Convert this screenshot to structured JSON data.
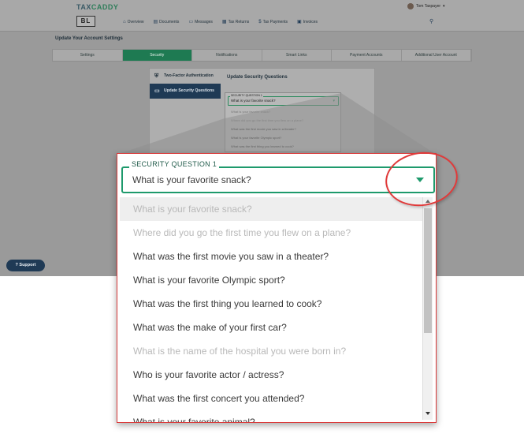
{
  "app": {
    "brand_tax": "TAX",
    "brand_caddy": "CADDY",
    "logo": "BL",
    "user_name": "Tom Taxpayer",
    "nav": [
      {
        "label": "Overview",
        "icon": "home-icon",
        "glyph": "⌂"
      },
      {
        "label": "Documents",
        "icon": "documents-icon",
        "glyph": "▤"
      },
      {
        "label": "Messages",
        "icon": "messages-icon",
        "glyph": "▭"
      },
      {
        "label": "Tax Returns",
        "icon": "tax-returns-icon",
        "glyph": "▦"
      },
      {
        "label": "Tax Payments",
        "icon": "tax-payments-icon",
        "glyph": "$"
      },
      {
        "label": "Invoices",
        "icon": "invoices-icon",
        "glyph": "▣"
      }
    ],
    "page_title": "Update Your Account Settings",
    "tabs": [
      {
        "label": "Settings",
        "active": false
      },
      {
        "label": "Security",
        "active": true
      },
      {
        "label": "Notifications",
        "active": false
      },
      {
        "label": "Smart Links",
        "active": false
      },
      {
        "label": "Payment Accounts",
        "active": false
      },
      {
        "label": "Additional User Account",
        "active": false
      }
    ],
    "side_items": [
      {
        "label": "Two-Factor Authentication",
        "icon": "shield-icon"
      },
      {
        "label": "Update Security Questions",
        "icon": "chat-icon"
      }
    ],
    "panel_heading": "Update Security Questions",
    "support_label": "Support"
  },
  "dropdown": {
    "label": "SECURITY QUESTION 1",
    "value": "What is your favorite snack?",
    "options": [
      {
        "text": "What is your favorite snack?",
        "disabled": true,
        "selected": true
      },
      {
        "text": "Where did you go the first time you flew on a plane?",
        "disabled": true,
        "selected": false
      },
      {
        "text": "What was the first movie you saw in a theater?",
        "disabled": false,
        "selected": false
      },
      {
        "text": "What is your favorite Olympic sport?",
        "disabled": false,
        "selected": false
      },
      {
        "text": "What was the first thing you learned to cook?",
        "disabled": false,
        "selected": false
      },
      {
        "text": "What was the make of your first car?",
        "disabled": false,
        "selected": false
      },
      {
        "text": "What is the name of the hospital you were born in?",
        "disabled": true,
        "selected": false
      },
      {
        "text": "Who is your favorite actor / actress?",
        "disabled": false,
        "selected": false
      },
      {
        "text": "What was the first concert you attended?",
        "disabled": false,
        "selected": false
      },
      {
        "text": "What is your favorite animal?",
        "disabled": false,
        "selected": false
      }
    ]
  },
  "colors": {
    "accent_green": "#1e9a6c",
    "callout_red": "#d93a3a",
    "navy": "#1f3a55"
  }
}
